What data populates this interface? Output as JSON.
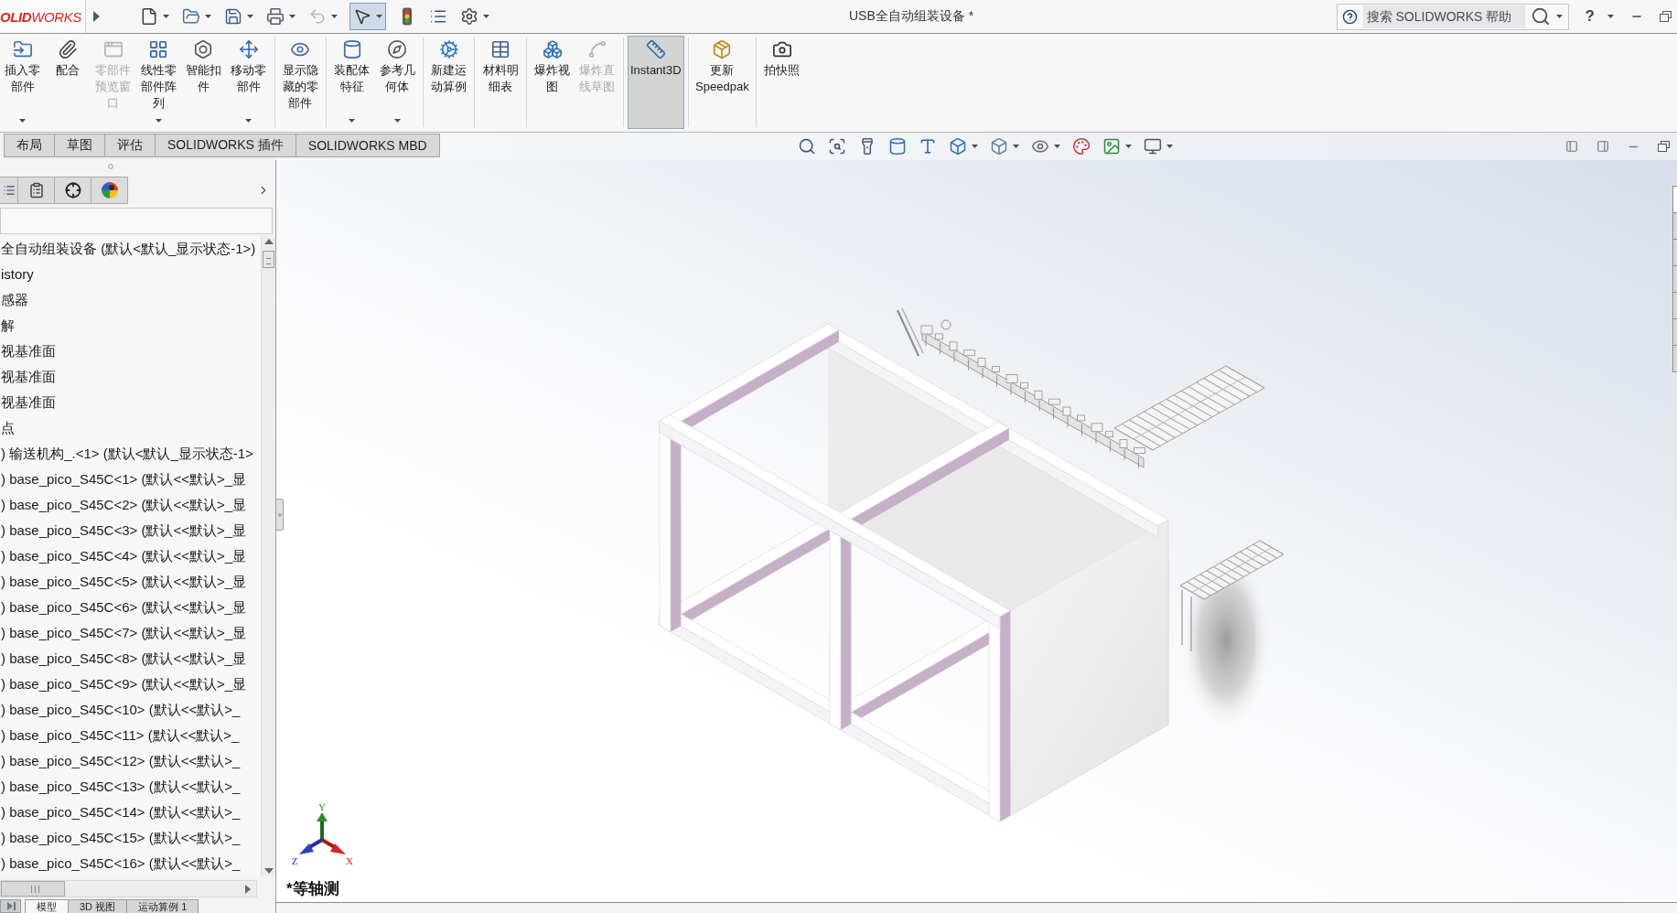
{
  "title_bar": {
    "logo": "**OLID**WORKS",
    "document_title": "USB全自动组装设备 *",
    "search": {
      "placeholder": "搜索 SOLIDWORKS 帮助"
    },
    "help": "?"
  },
  "quick_access": [
    {
      "dropdown": true,
      "disabled": false,
      "selected": false
    },
    {
      "dropdown": true,
      "disabled": false,
      "selected": false
    },
    {
      "dropdown": true,
      "disabled": false,
      "selected": false
    },
    {
      "dropdown": true,
      "disabled": false,
      "selected": false
    },
    {
      "dropdown": true,
      "disabled": true,
      "selected": false
    },
    {
      "dropdown": true,
      "disabled": false,
      "selected": true
    },
    {
      "dropdown": false,
      "disabled": false,
      "selected": false
    },
    {
      "dropdown": false,
      "disabled": false,
      "selected": false
    },
    {
      "dropdown": true,
      "disabled": false,
      "selected": false
    }
  ],
  "command_manager": {
    "groups": [
      {
        "buttons": [
          {
            "label": "插入零部件",
            "dropdown": true,
            "disabled": false,
            "selected": false
          },
          {
            "label": "配合",
            "dropdown": false,
            "disabled": false,
            "selected": false
          },
          {
            "label": "零部件预览窗口",
            "dropdown": false,
            "disabled": true,
            "selected": false
          },
          {
            "label": "线性零部件阵列",
            "dropdown": true,
            "disabled": false,
            "selected": false
          },
          {
            "label": "智能扣件",
            "dropdown": false,
            "disabled": false,
            "selected": false
          },
          {
            "label": "移动零部件",
            "dropdown": true,
            "disabled": false,
            "selected": false
          }
        ]
      },
      {
        "buttons": [
          {
            "label": "显示隐藏的零部件",
            "dropdown": false,
            "disabled": false,
            "selected": false
          }
        ]
      },
      {
        "buttons": [
          {
            "label": "装配体特征",
            "dropdown": true,
            "disabled": false,
            "selected": false
          },
          {
            "label": "参考几何体",
            "dropdown": true,
            "disabled": false,
            "selected": false
          }
        ]
      },
      {
        "buttons": [
          {
            "label": "新建运动算例",
            "dropdown": false,
            "disabled": false,
            "selected": false
          }
        ]
      },
      {
        "buttons": [
          {
            "label": "材料明细表",
            "dropdown": false,
            "disabled": false,
            "selected": false
          }
        ]
      },
      {
        "buttons": [
          {
            "label": "爆炸视图",
            "dropdown": false,
            "disabled": false,
            "selected": false
          },
          {
            "label": "爆炸直线草图",
            "dropdown": false,
            "disabled": true,
            "selected": false
          }
        ]
      },
      {
        "buttons": [
          {
            "label": "Instant3D",
            "dropdown": false,
            "disabled": false,
            "selected": true
          }
        ]
      },
      {
        "buttons": [
          {
            "label": "更新Speedpak",
            "dropdown": false,
            "disabled": false,
            "selected": false
          }
        ]
      },
      {
        "buttons": [
          {
            "label": "拍快照",
            "dropdown": false,
            "disabled": false,
            "selected": false
          }
        ]
      }
    ],
    "tabs": [
      {
        "label": "布局",
        "selected": false
      },
      {
        "label": "草图",
        "selected": false
      },
      {
        "label": "评估",
        "selected": false
      },
      {
        "label": "SOLIDWORKS 插件",
        "selected": false
      },
      {
        "label": "SOLIDWORKS MBD",
        "selected": false
      }
    ]
  },
  "view_toolbar": [
    {
      "dropdown": false
    },
    {
      "dropdown": false
    },
    {
      "dropdown": false
    },
    {
      "dropdown": false
    },
    {
      "dropdown": false
    },
    {
      "dropdown": true
    },
    {
      "dropdown": true
    },
    {
      "dropdown": true
    },
    {
      "dropdown": false
    },
    {
      "dropdown": true
    },
    {
      "dropdown": true
    }
  ],
  "feature_tree": {
    "label": "全自动组装设备 (默认<默认_显示状态-1>)",
    "children": [
      {
        "label": "istory"
      },
      {
        "label": "感器"
      },
      {
        "label": "解"
      },
      {
        "label": "视基准面"
      },
      {
        "label": "视基准面"
      },
      {
        "label": "视基准面"
      },
      {
        "label": "点"
      },
      {
        "label": ") 输送机构_.<1> (默认<默认_显示状态-1>"
      },
      {
        "label": ") base_pico_S45C<1> (默认<<默认>_显"
      },
      {
        "label": ") base_pico_S45C<2> (默认<<默认>_显"
      },
      {
        "label": ") base_pico_S45C<3> (默认<<默认>_显"
      },
      {
        "label": ") base_pico_S45C<4> (默认<<默认>_显"
      },
      {
        "label": ") base_pico_S45C<5> (默认<<默认>_显"
      },
      {
        "label": ") base_pico_S45C<6> (默认<<默认>_显"
      },
      {
        "label": ") base_pico_S45C<7> (默认<<默认>_显"
      },
      {
        "label": ") base_pico_S45C<8> (默认<<默认>_显"
      },
      {
        "label": ") base_pico_S45C<9> (默认<<默认>_显"
      },
      {
        "label": ") base_pico_S45C<10> (默认<<默认>_"
      },
      {
        "label": ") base_pico_S45C<11> (默认<<默认>_"
      },
      {
        "label": ") base_pico_S45C<12> (默认<<默认>_"
      },
      {
        "label": ") base_pico_S45C<13> (默认<<默认>_"
      },
      {
        "label": ") base_pico_S45C<14> (默认<<默认>_"
      },
      {
        "label": ") base_pico_S45C<15> (默认<<默认>_"
      },
      {
        "label": ") base_pico_S45C<16> (默认<<默认>_"
      }
    ]
  },
  "bottom_tabs": [
    {
      "label": "模型",
      "selected": true
    },
    {
      "label": "3D 视图",
      "selected": false
    },
    {
      "label": "运动算例 1",
      "selected": false
    }
  ],
  "task_pane": [
    {
      "selected": true
    },
    {
      "selected": false
    },
    {
      "selected": false
    },
    {
      "selected": false
    },
    {
      "selected": false
    },
    {
      "selected": false
    },
    {
      "selected": false
    }
  ],
  "viewport": {
    "view_name": "*等轴测",
    "triad": {
      "x": "X",
      "y": "Y",
      "z": "Z"
    }
  }
}
